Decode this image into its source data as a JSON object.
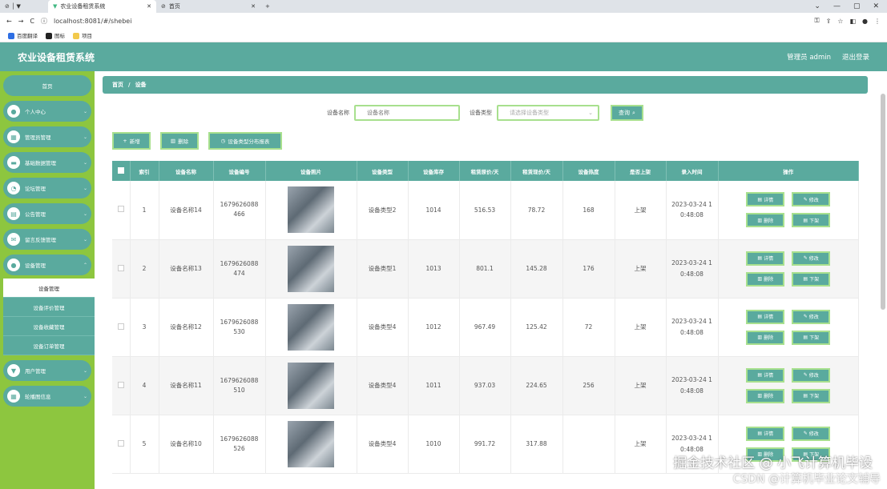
{
  "browser": {
    "tab_active": "农业设备租赁系统",
    "tab_inactive": "首页",
    "url": "localhost:8081/#/shebei",
    "bookmarks": [
      "百度翻译",
      "图标",
      "项目"
    ]
  },
  "header": {
    "title": "农业设备租赁系统",
    "user": "管理员 admin",
    "logout": "退出登录"
  },
  "sidebar": {
    "items": [
      {
        "label": "首页"
      },
      {
        "label": "个人中心"
      },
      {
        "label": "管理员管理"
      },
      {
        "label": "基础数据管理"
      },
      {
        "label": "论坛管理"
      },
      {
        "label": "公告管理"
      },
      {
        "label": "留言反馈管理"
      },
      {
        "label": "设备管理"
      }
    ],
    "sub_items": [
      "设备管理",
      "设备评价管理",
      "设备收藏管理",
      "设备订单管理"
    ],
    "items_after": [
      {
        "label": "用户管理"
      },
      {
        "label": "轮播图信息"
      }
    ]
  },
  "breadcrumb": {
    "home": "首页",
    "sep": "/",
    "current": "设备"
  },
  "search": {
    "name_label": "设备名称",
    "name_placeholder": "设备名称",
    "type_label": "设备类型",
    "type_placeholder": "请选择设备类型",
    "button": "查询"
  },
  "actions": {
    "add": "新增",
    "delete": "删除",
    "chart": "设备类型分布报表"
  },
  "table": {
    "headers": [
      "索引",
      "设备名称",
      "设备编号",
      "设备照片",
      "设备类型",
      "设备库存",
      "租赁原价/天",
      "租赁现价/天",
      "设备热度",
      "是否上架",
      "录入时间",
      "操作"
    ],
    "rows": [
      {
        "idx": "1",
        "name": "设备名称14",
        "code": "1679626088466",
        "type": "设备类型2",
        "stock": "1014",
        "orig": "516.53",
        "now": "78.72",
        "heat": "168",
        "shelf": "上架",
        "time": "2023-03-24 10:48:08"
      },
      {
        "idx": "2",
        "name": "设备名称13",
        "code": "1679626088474",
        "type": "设备类型1",
        "stock": "1013",
        "orig": "801.1",
        "now": "145.28",
        "heat": "176",
        "shelf": "上架",
        "time": "2023-03-24 10:48:08"
      },
      {
        "idx": "3",
        "name": "设备名称12",
        "code": "1679626088530",
        "type": "设备类型4",
        "stock": "1012",
        "orig": "967.49",
        "now": "125.42",
        "heat": "72",
        "shelf": "上架",
        "time": "2023-03-24 10:48:08"
      },
      {
        "idx": "4",
        "name": "设备名称11",
        "code": "1679626088510",
        "type": "设备类型4",
        "stock": "1011",
        "orig": "937.03",
        "now": "224.65",
        "heat": "256",
        "shelf": "上架",
        "time": "2023-03-24 10:48:08"
      },
      {
        "idx": "5",
        "name": "设备名称10",
        "code": "1679626088526",
        "type": "设备类型4",
        "stock": "1010",
        "orig": "991.72",
        "now": "317.88",
        "heat": "",
        "shelf": "上架",
        "time": "2023-03-24 10:48:08"
      }
    ],
    "ops": {
      "detail": "详情",
      "edit": "修改",
      "delete": "删除",
      "offshelf": "下架"
    }
  },
  "watermark": {
    "line1": "掘金技术社区 @ 小飞计算机毕设",
    "line2": "CSDN @计算机毕业论文辅导"
  },
  "colors": {
    "teal": "#5aaa9e",
    "green": "#8dc63f",
    "border": "#a8e08e"
  }
}
